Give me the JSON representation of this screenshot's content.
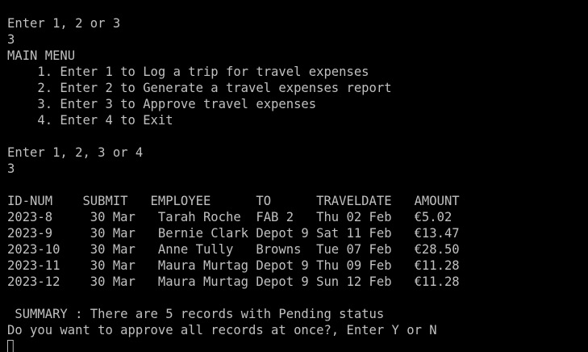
{
  "terminal": {
    "prompt_1": "Enter 1, 2 or 3",
    "input_1": "3",
    "menu_title": "MAIN MENU",
    "menu_items": [
      "    1. Enter 1 to Log a trip for travel expenses",
      "    2. Enter 2 to Generate a travel expenses report",
      "    3. Enter 3 to Approve travel expenses",
      "    4. Enter 4 to Exit"
    ],
    "prompt_2": "Enter 1, 2, 3 or 4",
    "input_2": "3",
    "table_header": "ID-NUM    SUBMIT   EMPLOYEE      TO      TRAVELDATE   AMOUNT",
    "table_rows": [
      "2023-8     30 Mar   Tarah Roche  FAB 2   Thu 02 Feb   €5.02",
      "2023-9     30 Mar   Bernie Clark Depot 9 Sat 11 Feb   €13.47",
      "2023-10    30 Mar   Anne Tully   Browns  Tue 07 Feb   €28.50",
      "2023-11    30 Mar   Maura Murtag Depot 9 Thu 09 Feb   €11.28",
      "2023-12    30 Mar   Maura Murtag Depot 9 Sun 12 Feb   €11.28"
    ],
    "summary": " SUMMARY : There are 5 records with Pending status",
    "prompt_3": "Do you want to approve all records at once?, Enter Y or N"
  },
  "colors": {
    "background": "#000000",
    "foreground": "#c0c0c0"
  }
}
